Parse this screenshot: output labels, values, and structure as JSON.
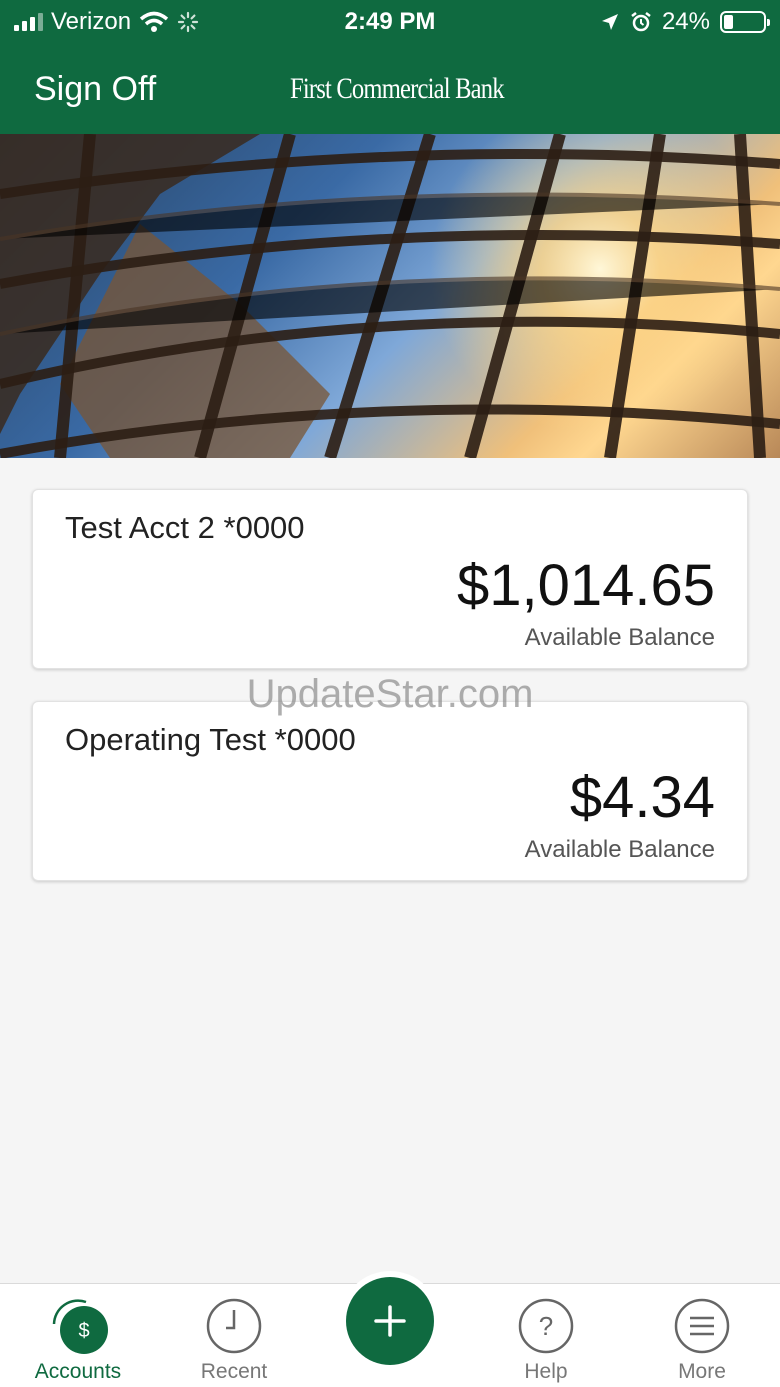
{
  "status_bar": {
    "carrier": "Verizon",
    "time": "2:49 PM",
    "battery": "24%",
    "battery_level": 0.24
  },
  "header": {
    "sign_off": "Sign Off",
    "logo_text": "First Commercial Bank"
  },
  "accounts": [
    {
      "name": "Test Acct 2 *0000",
      "balance": "$1,014.65",
      "balance_label": "Available Balance"
    },
    {
      "name": "Operating Test *0000",
      "balance": "$4.34",
      "balance_label": "Available Balance"
    }
  ],
  "watermark": "UpdateStar.com",
  "tabs": [
    {
      "label": "Accounts",
      "icon": "accounts-dollar-icon",
      "active": true
    },
    {
      "label": "Recent",
      "icon": "clock-icon",
      "active": false
    },
    {
      "label": "",
      "icon": "plus-icon",
      "active": false
    },
    {
      "label": "Help",
      "icon": "help-icon",
      "active": false
    },
    {
      "label": "More",
      "icon": "menu-icon",
      "active": false
    }
  ],
  "colors": {
    "brand_green": "#0f6a40",
    "background": "#f5f5f5"
  }
}
